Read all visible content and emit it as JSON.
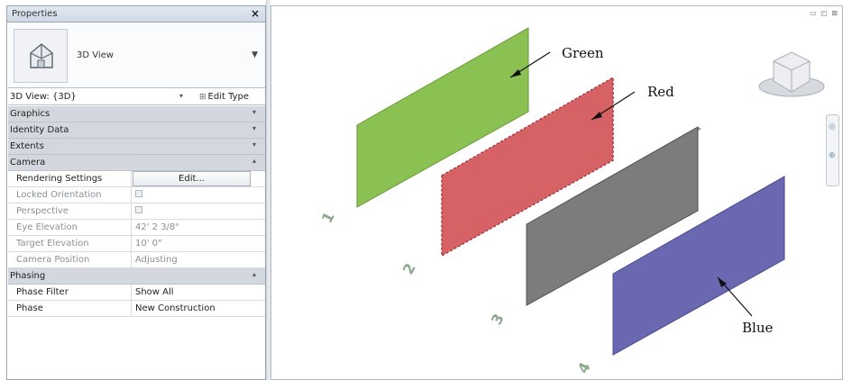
{
  "properties": {
    "title": "Properties",
    "close_glyph": "×",
    "type_selector": {
      "icon": "3d-view-icon",
      "name": "3D View"
    },
    "instance": {
      "value": "3D View: {3D}",
      "edit_type_label": "Edit Type"
    },
    "groups": {
      "graphics": "Graphics",
      "identity": "Identity Data",
      "extents": "Extents",
      "camera": "Camera",
      "phasing": "Phasing"
    },
    "camera_rows": {
      "rendering_settings": {
        "label": "Rendering Settings",
        "button": "Edit..."
      },
      "locked_orientation": {
        "label": "Locked Orientation"
      },
      "perspective": {
        "label": "Perspective"
      },
      "eye_elevation": {
        "label": "Eye Elevation",
        "value": "42'  2 3/8\""
      },
      "target_elevation": {
        "label": "Target Elevation",
        "value": "10'  0\""
      },
      "camera_position": {
        "label": "Camera Position",
        "value": "Adjusting"
      }
    },
    "phasing_rows": {
      "phase_filter": {
        "label": "Phase Filter",
        "value": "Show All"
      },
      "phase": {
        "label": "Phase",
        "value": "New Construction"
      }
    }
  },
  "viewport": {
    "view_controls": "▭ ◰ ⊠",
    "viewcube_icon": "viewcube-icon",
    "navbar_icons": [
      "steering-wheel-icon",
      "zoom-icon"
    ],
    "panels": [
      {
        "callout": "Green",
        "number": "1",
        "color": "#8bc152"
      },
      {
        "callout": "Red",
        "number": "2",
        "color": "#d76266"
      },
      {
        "callout": "",
        "number": "3",
        "color": "#7c7c7c"
      },
      {
        "callout": "Blue",
        "number": "4",
        "color": "#6a68b0"
      }
    ]
  },
  "colors": {
    "panel_header": "#d3d8df",
    "number_labels": "#8fa88f"
  }
}
